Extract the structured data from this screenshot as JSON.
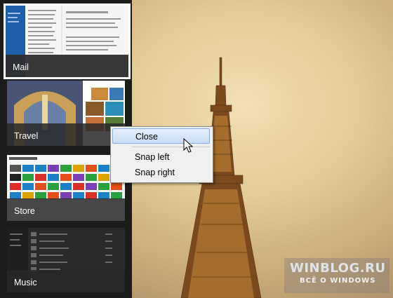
{
  "app_switcher": {
    "items": [
      {
        "label": "Mail",
        "selected": true
      },
      {
        "label": "Travel"
      },
      {
        "label": "Store"
      },
      {
        "label": "Music"
      }
    ]
  },
  "context_menu": {
    "items": [
      {
        "label": "Close",
        "highlighted": true
      },
      {
        "label": "Snap left"
      },
      {
        "label": "Snap right"
      }
    ]
  },
  "watermark": {
    "title": "WINBLOG.RU",
    "subtitle": "ВСЁ О WINDOWS"
  },
  "icons": [
    "mouse-cursor-icon"
  ],
  "colors": {
    "menu_highlight": "#c9dcf5",
    "switcher_bg": "#1c1c1c",
    "selected_border": "#ffffff"
  }
}
